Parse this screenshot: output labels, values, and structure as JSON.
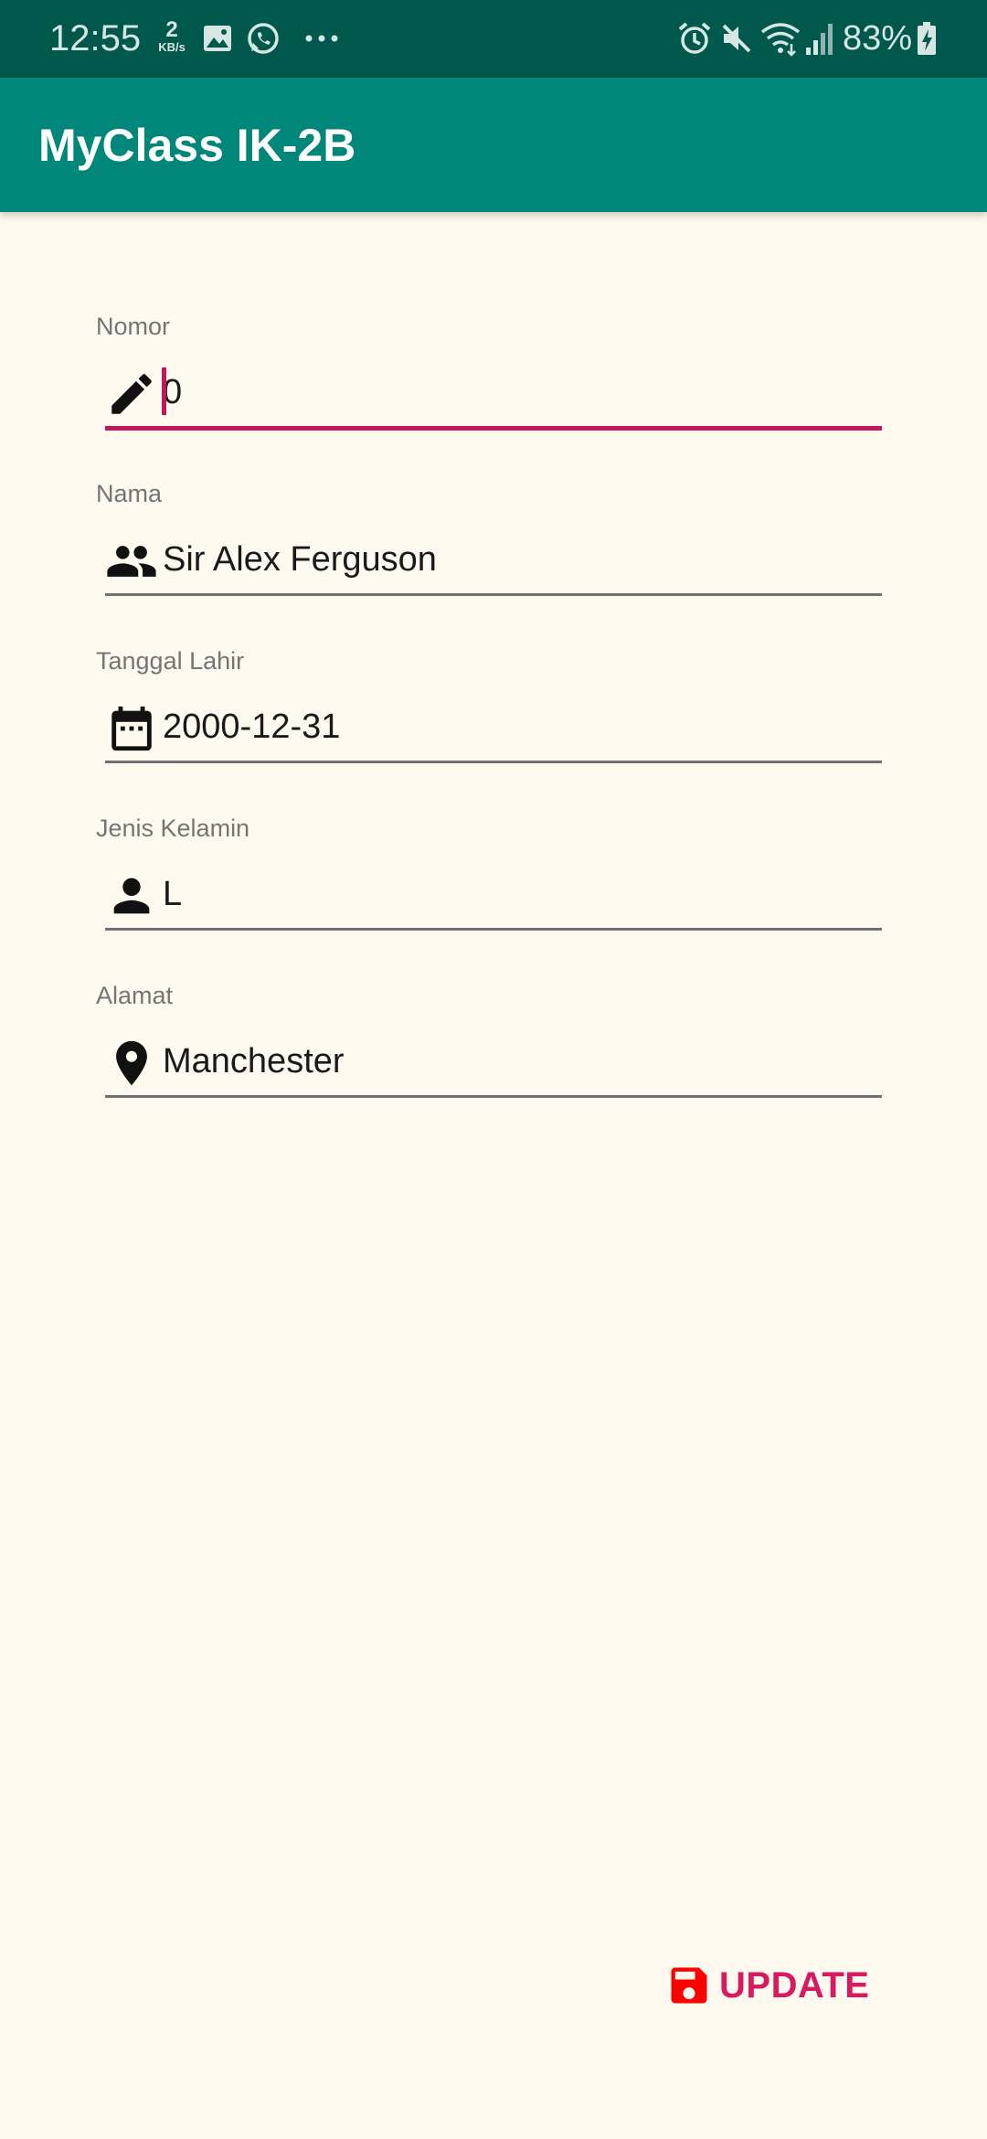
{
  "status_bar": {
    "time": "12:55",
    "net_speed_value": "2",
    "net_speed_unit": "KB/s",
    "battery": "83%",
    "icons": [
      "image-notification-icon",
      "whatsapp-icon",
      "more-notifications-icon",
      "alarm-icon",
      "mute-icon",
      "wifi-icon",
      "signal-icon",
      "battery-charging-icon"
    ]
  },
  "app_bar": {
    "title": "MyClass IK-2B",
    "color": "#00877A"
  },
  "form": {
    "nomor": {
      "label": "Nomor",
      "value": "0",
      "icon": "pencil-icon"
    },
    "nama": {
      "label": "Nama",
      "value": "Sir Alex Ferguson",
      "icon": "people-icon"
    },
    "tanggal_lahir": {
      "label": "Tanggal Lahir",
      "value": "2000-12-31",
      "icon": "calendar-icon"
    },
    "jenis_kelamin": {
      "label": "Jenis Kelamin",
      "value": "L",
      "icon": "person-icon"
    },
    "alamat": {
      "label": "Alamat",
      "value": "Manchester",
      "icon": "location-pin-icon"
    }
  },
  "actions": {
    "update_label": "UPDATE",
    "update_icon": "save-icon",
    "accent_color": "#D81B60",
    "icon_color": "#FF0000"
  },
  "colors": {
    "background": "#FFFAEF",
    "status_bar": "#00574B",
    "focus_underline": "#C2185B"
  }
}
